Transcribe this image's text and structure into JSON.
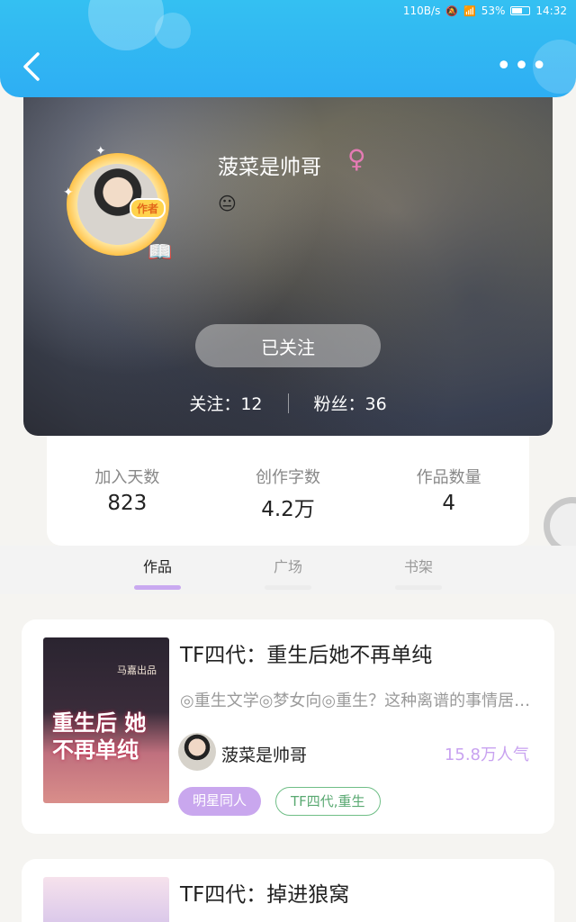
{
  "status_bar": {
    "speed": "110B/s",
    "battery": "53%",
    "time": "14:32"
  },
  "header": {
    "back_icon": "chevron-left-icon",
    "more_icon": "more-dots-icon"
  },
  "profile": {
    "name": "菠菜是帅哥",
    "gender_symbol": "♀",
    "emoji": "😐",
    "author_badge": "作者",
    "follow_button": "已关注",
    "following_label": "关注：12",
    "followers_label": "粉丝：36"
  },
  "stats": [
    {
      "label": "加入天数",
      "value": "823"
    },
    {
      "label": "创作字数",
      "value": "4.2万"
    },
    {
      "label": "作品数量",
      "value": "4"
    }
  ],
  "tabs": [
    {
      "label": "作品",
      "active": true
    },
    {
      "label": "广场",
      "active": false
    },
    {
      "label": "书架",
      "active": false
    }
  ],
  "books": [
    {
      "title": "TF四代：重生后她不再单纯",
      "description": "◎重生文学◎梦女向◎重生？这种离谱的事情居然发生在了我身上",
      "author": "菠菜是帅哥",
      "popularity": "15.8万人气",
      "tags": [
        "明星同人",
        "TF四代,重生"
      ],
      "cover_text": "重生后 她不再单纯",
      "cover_tag": "马嘉出品"
    },
    {
      "title": "TF四代：掉进狼窝"
    }
  ],
  "colors": {
    "header": "#2eaef3",
    "accent": "#c9a7ee",
    "tag_outline": "#6fbe86"
  }
}
